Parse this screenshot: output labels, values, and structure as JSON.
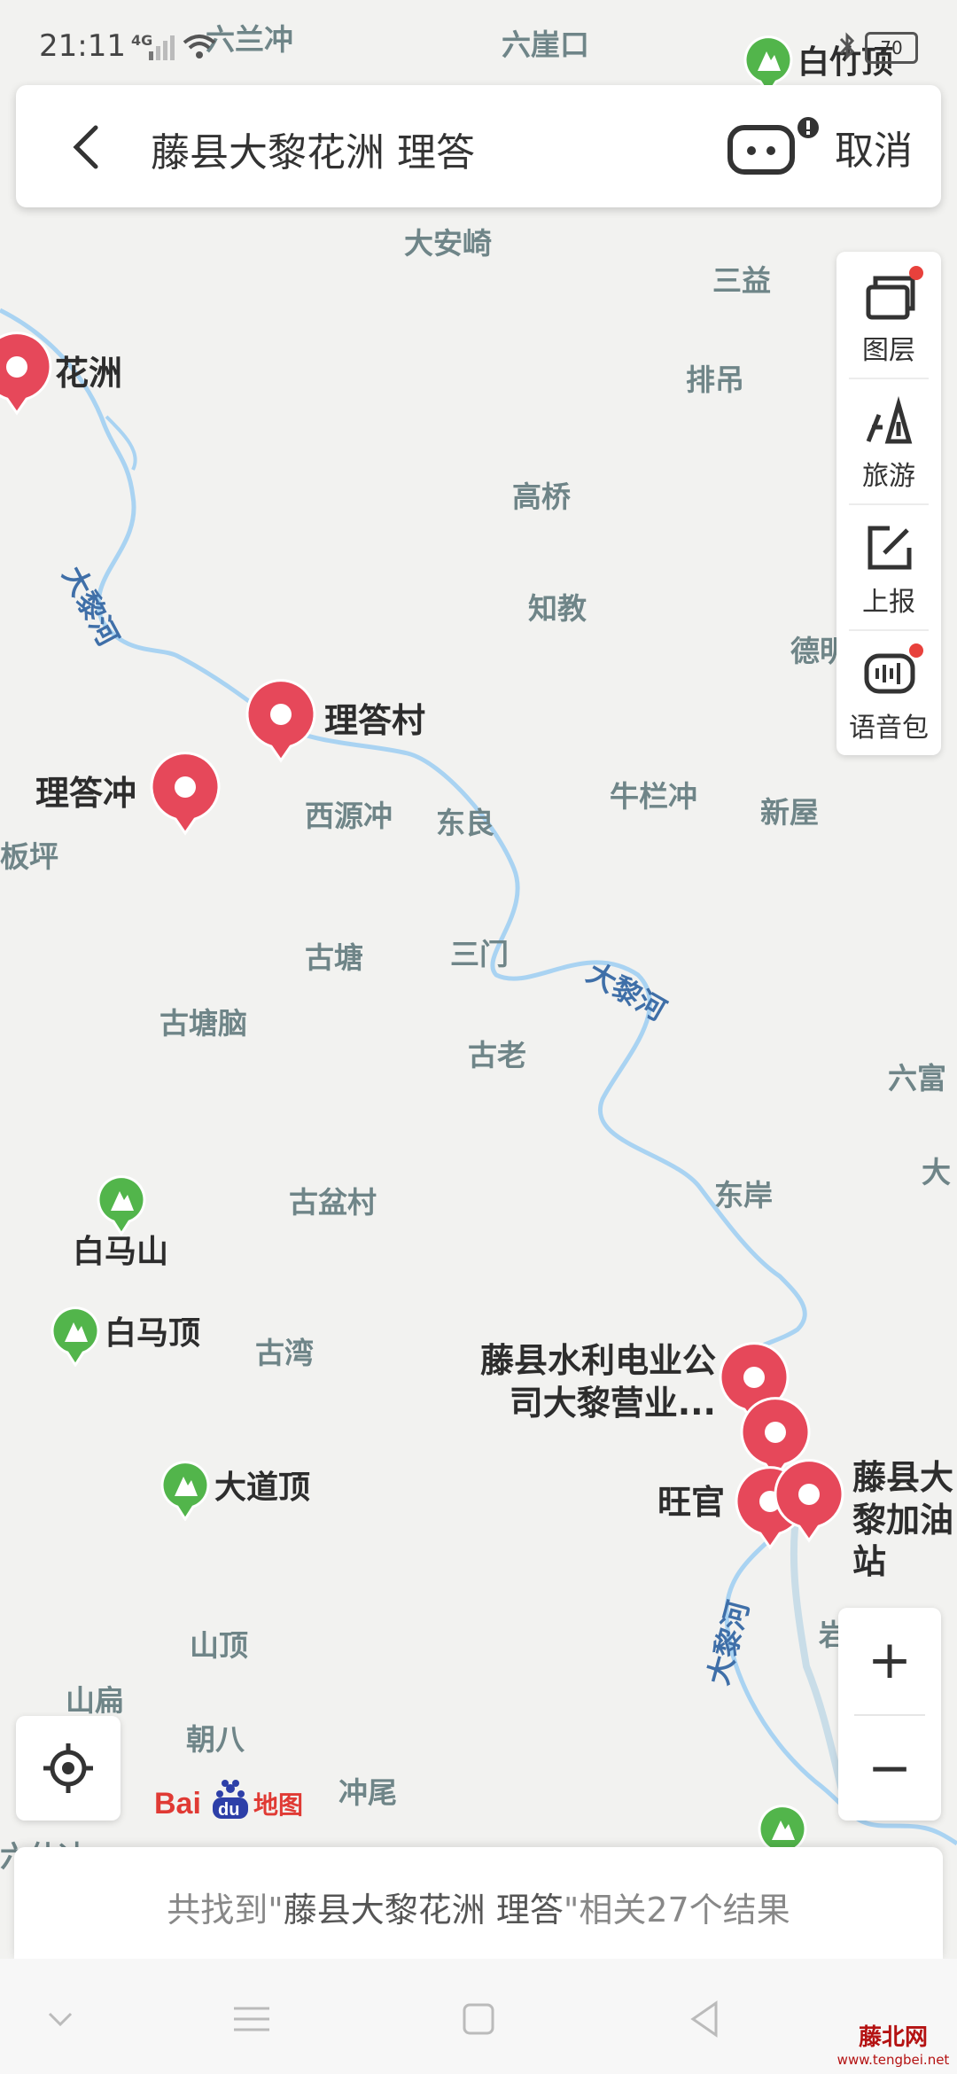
{
  "status_bar": {
    "time": "21:11",
    "network": "4G",
    "battery": "70"
  },
  "search": {
    "query": "藤县大黎花洲 理答",
    "cancel_label": "取消"
  },
  "side_tools": [
    {
      "label": "图层",
      "icon": "layers-icon"
    },
    {
      "label": "旅游",
      "icon": "travel-icon"
    },
    {
      "label": "上报",
      "icon": "report-edit-icon"
    },
    {
      "label": "语音包",
      "icon": "voice-pack-icon"
    }
  ],
  "map": {
    "place_labels": [
      "六兰冲",
      "六崖口",
      "大安崎",
      "三益",
      "排吊",
      "高桥",
      "知教",
      "德明",
      "牛栏冲",
      "新屋",
      "西源冲",
      "东良",
      "板坪",
      "古塘",
      "三门",
      "古塘脑",
      "古老",
      "六富",
      "东岸",
      "古盆村",
      "古湾",
      "大",
      "岩",
      "山顶",
      "山扁",
      "朝八",
      "冲尾",
      "六仙冲"
    ],
    "river_name": "大黎河",
    "poi_results": [
      "花洲",
      "理答村",
      "理答冲",
      "藤县水利电业公司大黎营业...",
      "旺官",
      "藤县大黎加油站"
    ],
    "mountains": [
      "白竹顶",
      "白马山",
      "白马顶",
      "大道顶"
    ]
  },
  "map_logo": "Bai du 地图",
  "result_summary": {
    "prefix": "共找到\"",
    "query": "藤县大黎花洲 理答",
    "suffix": "\"相关27个结果"
  },
  "zoom": {
    "in_label": "+",
    "out_label": "−"
  },
  "watermark": {
    "name": "藤北网",
    "url": "www.tengbei.net"
  },
  "colors": {
    "pin_red": "#e6485a",
    "river": "#a9d3f2",
    "map_bg": "#f2f2f0",
    "accent_dot": "#e8413c",
    "mountain_green": "#52b54b"
  }
}
